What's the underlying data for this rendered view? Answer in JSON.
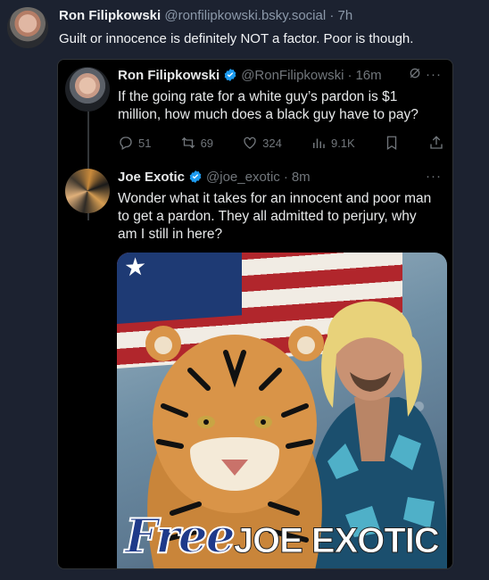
{
  "bluesky_post": {
    "author_name": "Ron Filipkowski",
    "author_handle": "@ronfilipkowski.bsky.social",
    "separator": "·",
    "time": "7h",
    "text": "Guilt or innocence is definitely NOT a factor. Poor is though."
  },
  "x_thread": {
    "tweet1": {
      "name": "Ron Filipkowski",
      "handle": "@RonFilipkowski",
      "separator": "·",
      "time": "16m",
      "text": "If the going rate for a white guy’s pardon is $1 million, how much does a black guy have to pay?",
      "stats": {
        "replies": "51",
        "retweets": "69",
        "likes": "324",
        "views": "9.1K"
      }
    },
    "tweet2": {
      "name": "Joe Exotic",
      "handle": "@joe_exotic",
      "separator": "·",
      "time": "8m",
      "text": "Wonder what it takes for an innocent and poor man to get a pardon.  They all admitted to perjury, why am I still in here?",
      "image_text_free": "Free",
      "image_text_name": "JOE EXOTIC"
    },
    "more_label": "···"
  },
  "colors": {
    "verified": "#1d9bf0",
    "background": "#1c2230",
    "x_background": "#000000"
  },
  "icons": [
    "reply-icon",
    "retweet-icon",
    "like-icon",
    "views-icon",
    "bookmark-icon",
    "share-icon",
    "grok-icon",
    "verified-icon",
    "star-icon"
  ]
}
